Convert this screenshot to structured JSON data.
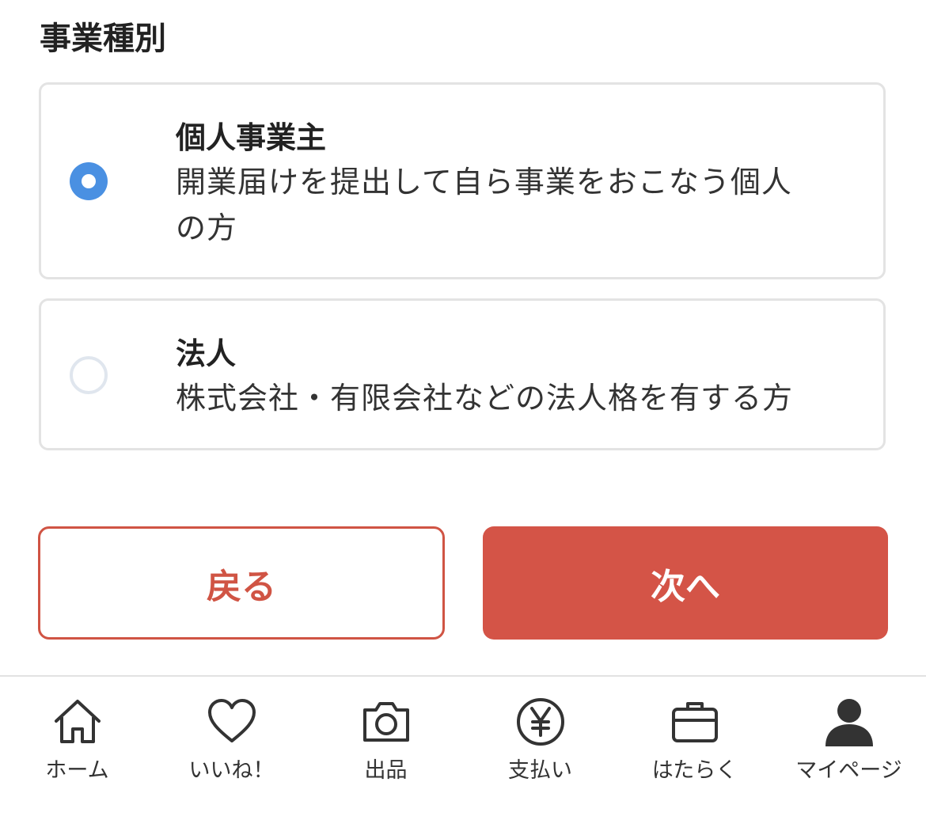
{
  "section": {
    "title": "事業種別"
  },
  "options": [
    {
      "title": "個人事業主",
      "description_line1": "開業届けを提出して自ら事業をおこなう個人",
      "description_line2": "の方",
      "selected": true
    },
    {
      "title": "法人",
      "description": "株式会社・有限会社などの法人格を有する方",
      "selected": false
    }
  ],
  "buttons": {
    "back_label": "戻る",
    "next_label": "次へ"
  },
  "tabbar": {
    "items": [
      {
        "label": "ホーム",
        "icon": "home-icon"
      },
      {
        "label": "いいね！",
        "icon": "heart-icon"
      },
      {
        "label": "出品",
        "icon": "camera-icon"
      },
      {
        "label": "支払い",
        "icon": "yen-icon"
      },
      {
        "label": "はたらく",
        "icon": "briefcase-icon"
      },
      {
        "label": "マイページ",
        "icon": "person-icon"
      }
    ]
  },
  "colors": {
    "accent": "#d45447",
    "radio_selected": "#4a90e2",
    "border": "#e3e3e3"
  }
}
